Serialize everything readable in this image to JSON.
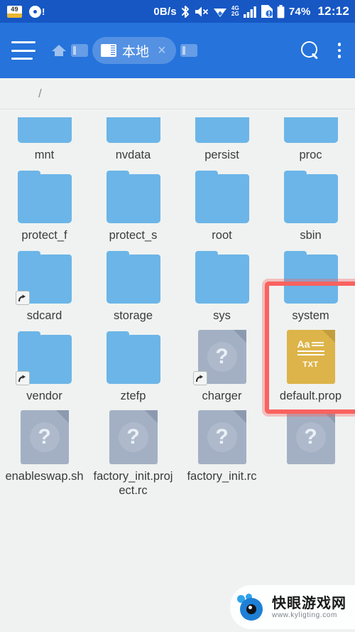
{
  "statusbar": {
    "left_icons": [
      {
        "name": "note-badge-icon",
        "value": "49"
      },
      {
        "name": "disc-alert-icon",
        "value": "!"
      }
    ],
    "network_rate": "0B/s",
    "icons": [
      "bluetooth-icon",
      "volume-mute-icon",
      "wifi-icon",
      "4g-2g-icon",
      "signal-bars-icon",
      "sim-alert-icon",
      "battery-icon"
    ],
    "network_gen_top": "4G",
    "network_gen_bottom": "2G",
    "battery_percent": "74%",
    "clock": "12:12"
  },
  "toolbar": {
    "menu_label": "menu",
    "home_label": "home",
    "tab": {
      "label": "本地",
      "close_label": "×"
    },
    "search_label": "search",
    "overflow_label": "more options"
  },
  "breadcrumb": {
    "path": "/"
  },
  "colors": {
    "status_bar": "#1657C4",
    "toolbar": "#2573DB",
    "page_background": "#EFF2F1",
    "folder_blue": "#6CB5E8",
    "unknown_file": "#A3B0C4",
    "txt_file": "#DDB449",
    "highlight_red": "#F9625F",
    "label_text": "#3B3B3B"
  },
  "highlight": {
    "target": "system",
    "note": "red rectangle drawn around the system folder"
  },
  "grid": {
    "rows": [
      {
        "clipped": true,
        "items": [
          {
            "name": "mnt",
            "type": "folder",
            "shortcut": false
          },
          {
            "name": "nvdata",
            "type": "folder",
            "shortcut": false
          },
          {
            "name": "persist",
            "type": "folder",
            "shortcut": false
          },
          {
            "name": "proc",
            "type": "folder",
            "shortcut": false
          }
        ]
      },
      {
        "clipped": false,
        "items": [
          {
            "name": "protect_f",
            "type": "folder",
            "shortcut": false
          },
          {
            "name": "protect_s",
            "type": "folder",
            "shortcut": false
          },
          {
            "name": "root",
            "type": "folder",
            "shortcut": false
          },
          {
            "name": "sbin",
            "type": "folder",
            "shortcut": false
          }
        ]
      },
      {
        "clipped": false,
        "items": [
          {
            "name": "sdcard",
            "type": "folder",
            "shortcut": true
          },
          {
            "name": "storage",
            "type": "folder",
            "shortcut": false
          },
          {
            "name": "sys",
            "type": "folder",
            "shortcut": false
          },
          {
            "name": "system",
            "type": "folder",
            "shortcut": false
          }
        ]
      },
      {
        "clipped": false,
        "items": [
          {
            "name": "vendor",
            "type": "folder",
            "shortcut": true
          },
          {
            "name": "ztefp",
            "type": "folder",
            "shortcut": false
          },
          {
            "name": "charger",
            "type": "unknown",
            "shortcut": true
          },
          {
            "name": "default.prop",
            "type": "txt",
            "shortcut": false,
            "file_kind": "TXT",
            "file_glyph": "Aa"
          }
        ]
      },
      {
        "clipped": false,
        "items": [
          {
            "name": "enableswap.sh",
            "type": "unknown",
            "shortcut": false
          },
          {
            "name": "factory_init.project.rc",
            "type": "unknown",
            "shortcut": false
          },
          {
            "name": "factory_init.rc",
            "type": "unknown",
            "shortcut": false
          },
          {
            "name": "",
            "type": "unknown",
            "shortcut": false
          }
        ]
      }
    ]
  },
  "watermark": {
    "site_name": "快眼游戏网",
    "url": "www.kyligting.com"
  }
}
